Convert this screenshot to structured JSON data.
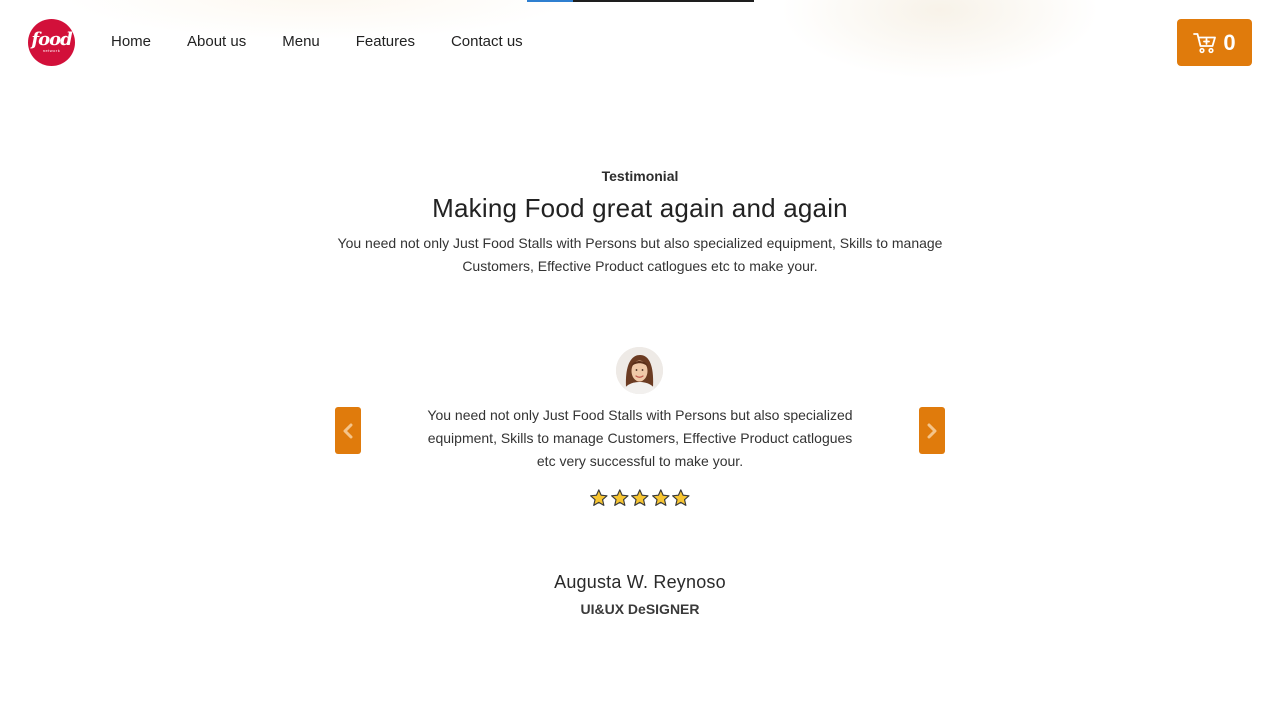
{
  "header": {
    "logo_text": "food",
    "logo_subtext": "network",
    "nav": [
      {
        "label": "Home"
      },
      {
        "label": "About us"
      },
      {
        "label": "Menu"
      },
      {
        "label": "Features"
      },
      {
        "label": "Contact us"
      }
    ],
    "cart": {
      "icon": "cart-icon",
      "count": "0"
    }
  },
  "section": {
    "eyebrow": "Testimonial",
    "title": "Making Food great again and again",
    "intro": "You need not only Just Food Stalls with Persons but also specialized equipment, Skills to manage Customers, Effective Product catlogues etc to make your."
  },
  "testimonial": {
    "quote": "You need not only Just Food Stalls with Persons but also specialized equipment, Skills to manage Customers, Effective Product catlogues etc very successful to make your.",
    "rating": 5,
    "rating_max": 5,
    "name": "Augusta W. Reynoso",
    "role": "UI&UX DeSIGNER"
  },
  "colors": {
    "accent": "#e07b0c",
    "logo": "#d2103a",
    "star_fill": "#f7c531"
  }
}
